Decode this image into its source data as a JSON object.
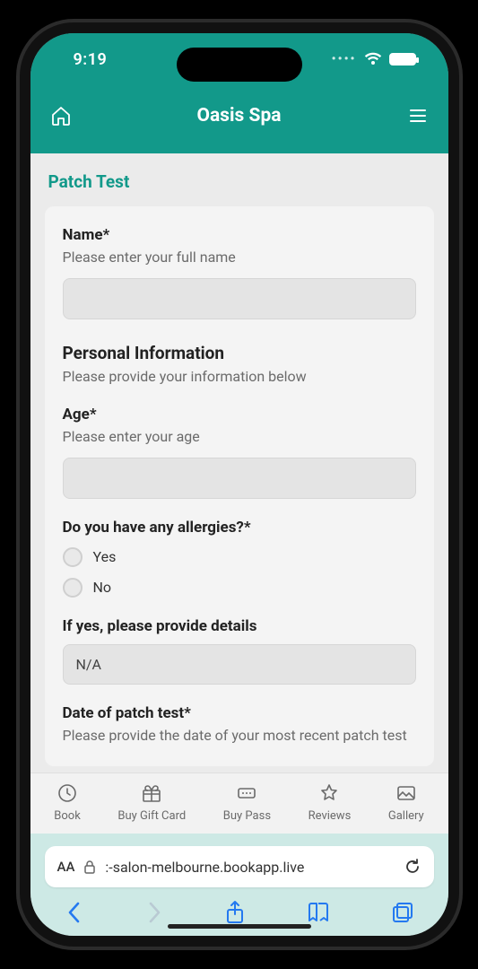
{
  "status": {
    "time": "9:19"
  },
  "header": {
    "title": "Oasis Spa"
  },
  "page": {
    "title": "Patch Test"
  },
  "form": {
    "name": {
      "label": "Name*",
      "help": "Please enter your full name",
      "value": ""
    },
    "section": {
      "title": "Personal Information",
      "help": "Please provide your information below"
    },
    "age": {
      "label": "Age*",
      "help": "Please enter your age",
      "value": ""
    },
    "allergies": {
      "label": "Do you have any allergies?*",
      "options": [
        "Yes",
        "No"
      ]
    },
    "allergy_details": {
      "label": "If yes, please provide details",
      "value": "N/A"
    },
    "patch_date": {
      "label": "Date of patch test*",
      "help": "Please provide the date of your most recent patch test"
    }
  },
  "tabs": {
    "book": "Book",
    "giftcard": "Buy Gift Card",
    "pass": "Buy Pass",
    "reviews": "Reviews",
    "gallery": "Gallery"
  },
  "safari": {
    "aa": "AA",
    "url": ":-salon-melbourne.bookapp.live"
  }
}
